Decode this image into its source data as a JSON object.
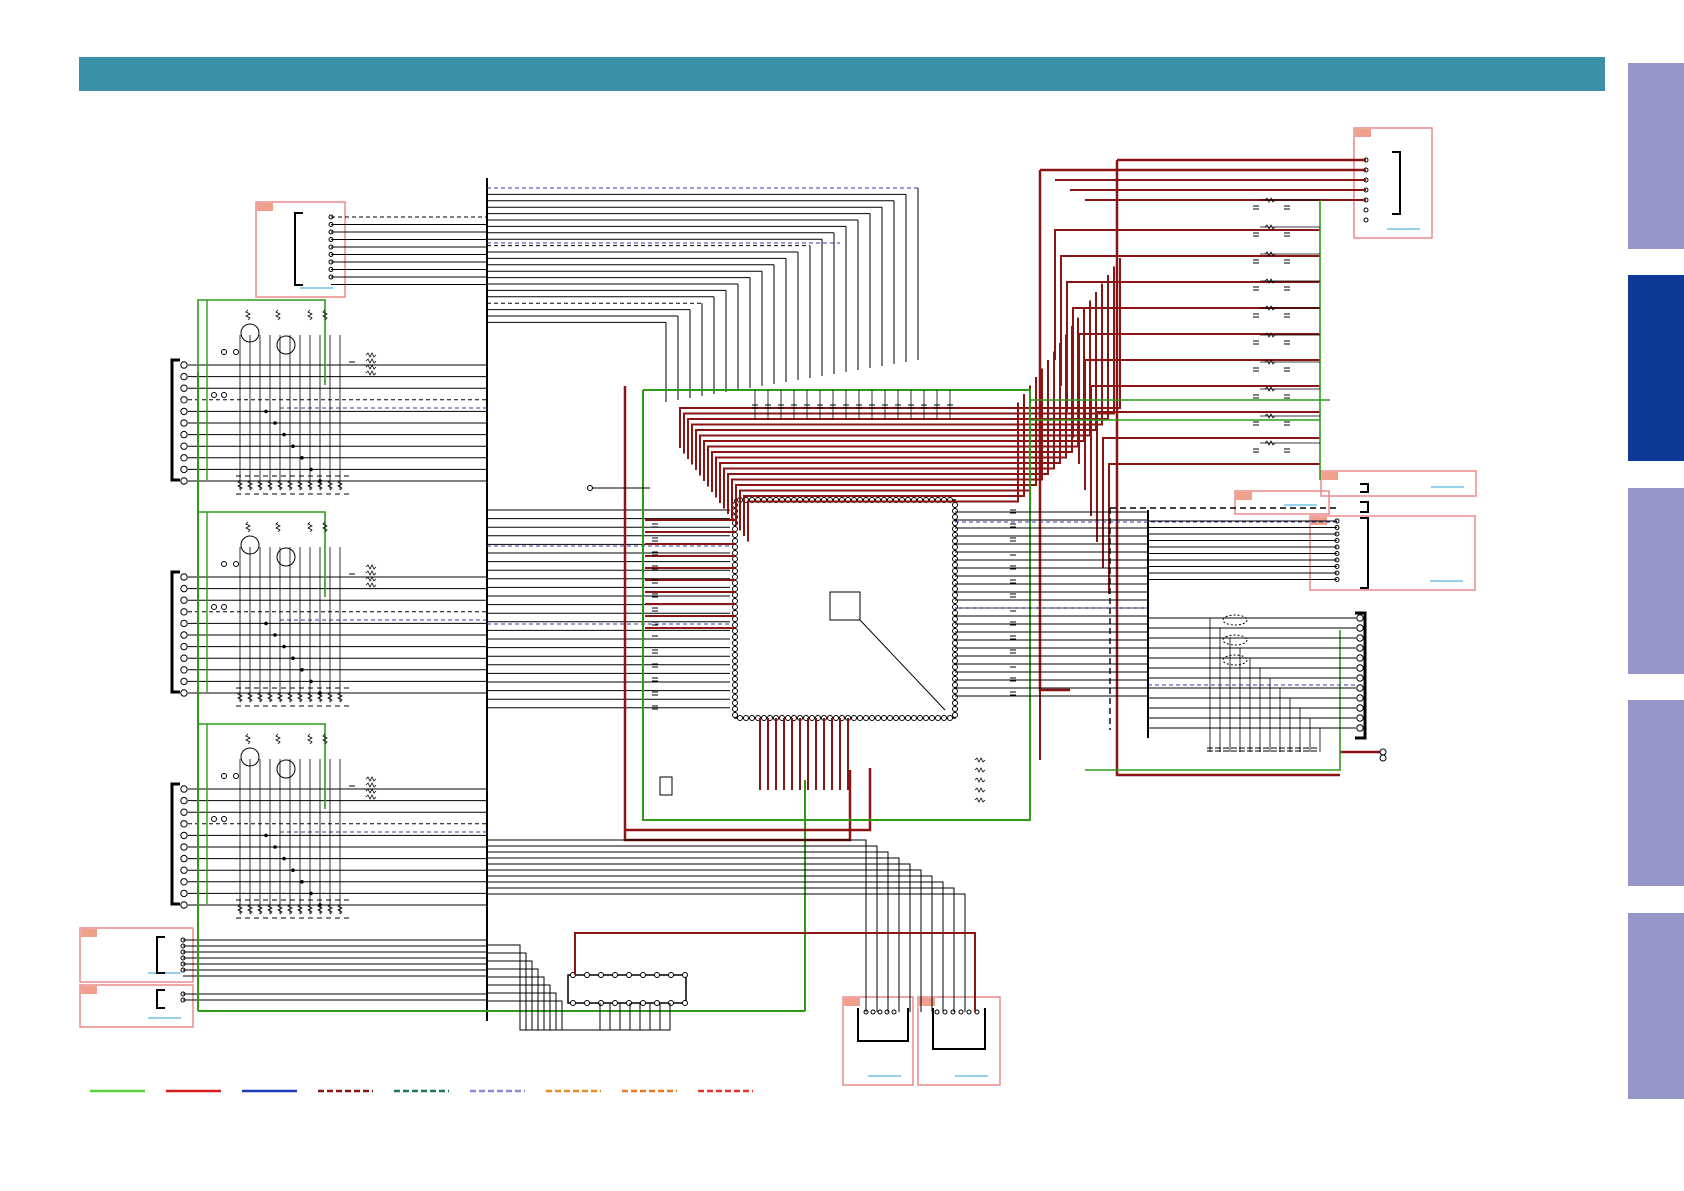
{
  "header": {
    "title": ""
  },
  "side_tabs": [
    {
      "label": "",
      "active": false
    },
    {
      "label": "",
      "active": true
    },
    {
      "label": "",
      "active": false
    },
    {
      "label": "",
      "active": false
    },
    {
      "label": "",
      "active": false
    }
  ],
  "colors": {
    "header_bar": "#3a90a6",
    "side_tab_inactive": "#9696c8",
    "side_tab_active": "#0e3a96",
    "wire_signal": "#000000",
    "wire_power_red": "#8b1414",
    "wire_ground_green": "#2f9a1a",
    "wire_dashed_blue": "#3a3aa8",
    "connector_box_border": "#e88c8c",
    "connector_tag_fill": "#f0a08c",
    "link_underline": "#2aa0d8"
  },
  "legend": [
    {
      "color": "#5cd23a",
      "style": "solid"
    },
    {
      "color": "#d81e1e",
      "style": "solid"
    },
    {
      "color": "#1e3cb4",
      "style": "solid"
    },
    {
      "color": "#8b1414",
      "style": "dashed"
    },
    {
      "color": "#1e7850",
      "style": "dashed"
    },
    {
      "color": "#8c8cdc",
      "style": "dashed"
    },
    {
      "color": "#e68c28",
      "style": "dashed"
    },
    {
      "color": "#e67828",
      "style": "dashed"
    },
    {
      "color": "#e63232",
      "style": "dashed"
    }
  ]
}
